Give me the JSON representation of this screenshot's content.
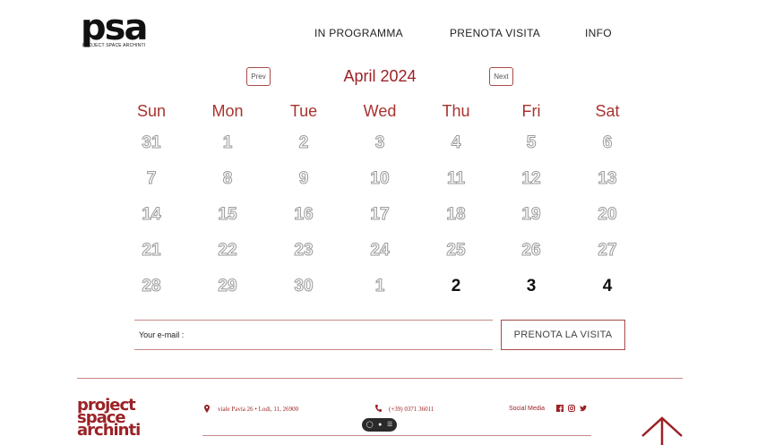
{
  "header": {
    "logo_text": "psa",
    "logo_subtitle": "PROJECT SPACE ARCHINTI",
    "nav": [
      "IN PROGRAMMA",
      "PRENOTA VISITA",
      "INFO"
    ]
  },
  "calendar": {
    "prev_label": "Prev",
    "next_label": "Next",
    "month_label": "April 2024",
    "weekdays": [
      "Sun",
      "Mon",
      "Tue",
      "Wed",
      "Thu",
      "Fri",
      "Sat"
    ],
    "weeks": [
      [
        "31",
        "1",
        "2",
        "3",
        "4",
        "5",
        "6"
      ],
      [
        "7",
        "8",
        "9",
        "10",
        "11",
        "12",
        "13"
      ],
      [
        "14",
        "15",
        "16",
        "17",
        "18",
        "19",
        "20"
      ],
      [
        "21",
        "22",
        "23",
        "24",
        "25",
        "26",
        "27"
      ],
      [
        "28",
        "29",
        "30",
        "1",
        "2",
        "3",
        "4"
      ]
    ],
    "selectable_from_index": 32
  },
  "booking": {
    "email_label": "Your e-mail :",
    "email_value": "",
    "submit_label": "PRENOTA LA VISITA"
  },
  "footer": {
    "logo_lines": [
      "project",
      "space",
      "archinti"
    ],
    "address": "viale Pavia 26 • Lodi, 11, 26900",
    "phone": "(+39) 0371 36011",
    "social_label": "Social Media",
    "social_icons": [
      "facebook-icon",
      "instagram-icon",
      "twitter-icon"
    ]
  },
  "colors": {
    "accent": "#9b2226",
    "border": "#c48a88"
  }
}
